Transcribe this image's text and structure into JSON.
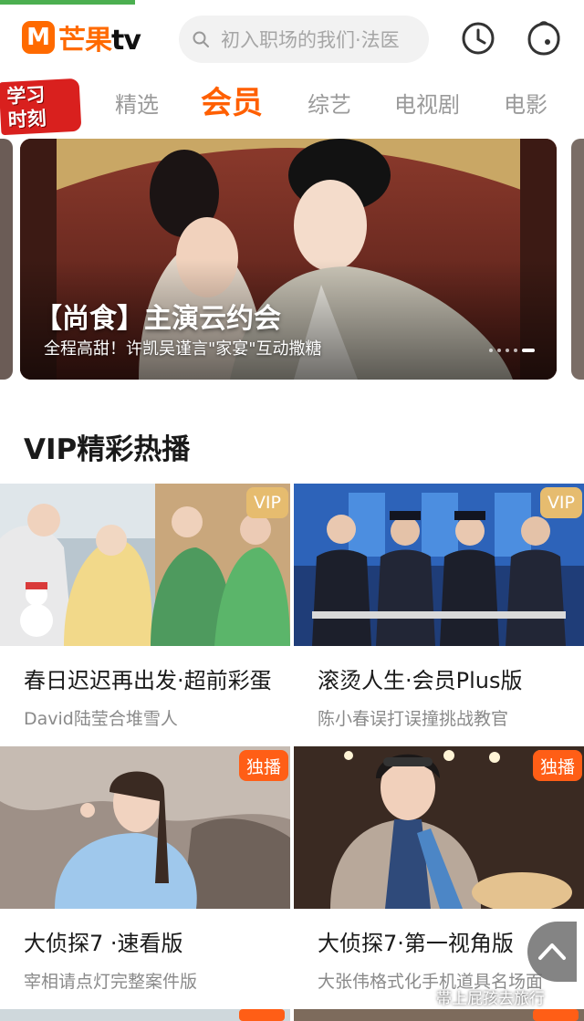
{
  "header": {
    "logo": "芒果tv",
    "search_placeholder": "初入职场的我们·法医"
  },
  "promo_badge": "学习时刻",
  "tabs": [
    {
      "label": "精选"
    },
    {
      "label": "会员"
    },
    {
      "label": "综艺"
    },
    {
      "label": "电视剧"
    },
    {
      "label": "电影"
    }
  ],
  "banner": {
    "title": "【尚食】主演云约会",
    "subtitle": "全程高甜！许凯吴谨言\"家宴\"互动撒糖"
  },
  "section": {
    "title": "VIP精彩热播"
  },
  "cards": [
    {
      "title": "春日迟迟再出发·超前彩蛋",
      "subtitle": "David陆莹合堆雪人",
      "badge": "VIP"
    },
    {
      "title": "滚烫人生·会员Plus版",
      "subtitle": "陈小春误打误撞挑战教官",
      "badge": "VIP"
    },
    {
      "title": "大侦探7 ·速看版",
      "subtitle": "宰相请点灯完整案件版",
      "badge": "独播"
    },
    {
      "title": "大侦探7·第一视角版",
      "subtitle": "大张伟格式化手机道具名场面",
      "badge": "独播"
    }
  ],
  "watermark": "帯上屁孩去旅行",
  "colors": {
    "accent": "#ff5f00",
    "vip": "#e6bc6f",
    "exclusive": "#ff5e16"
  }
}
